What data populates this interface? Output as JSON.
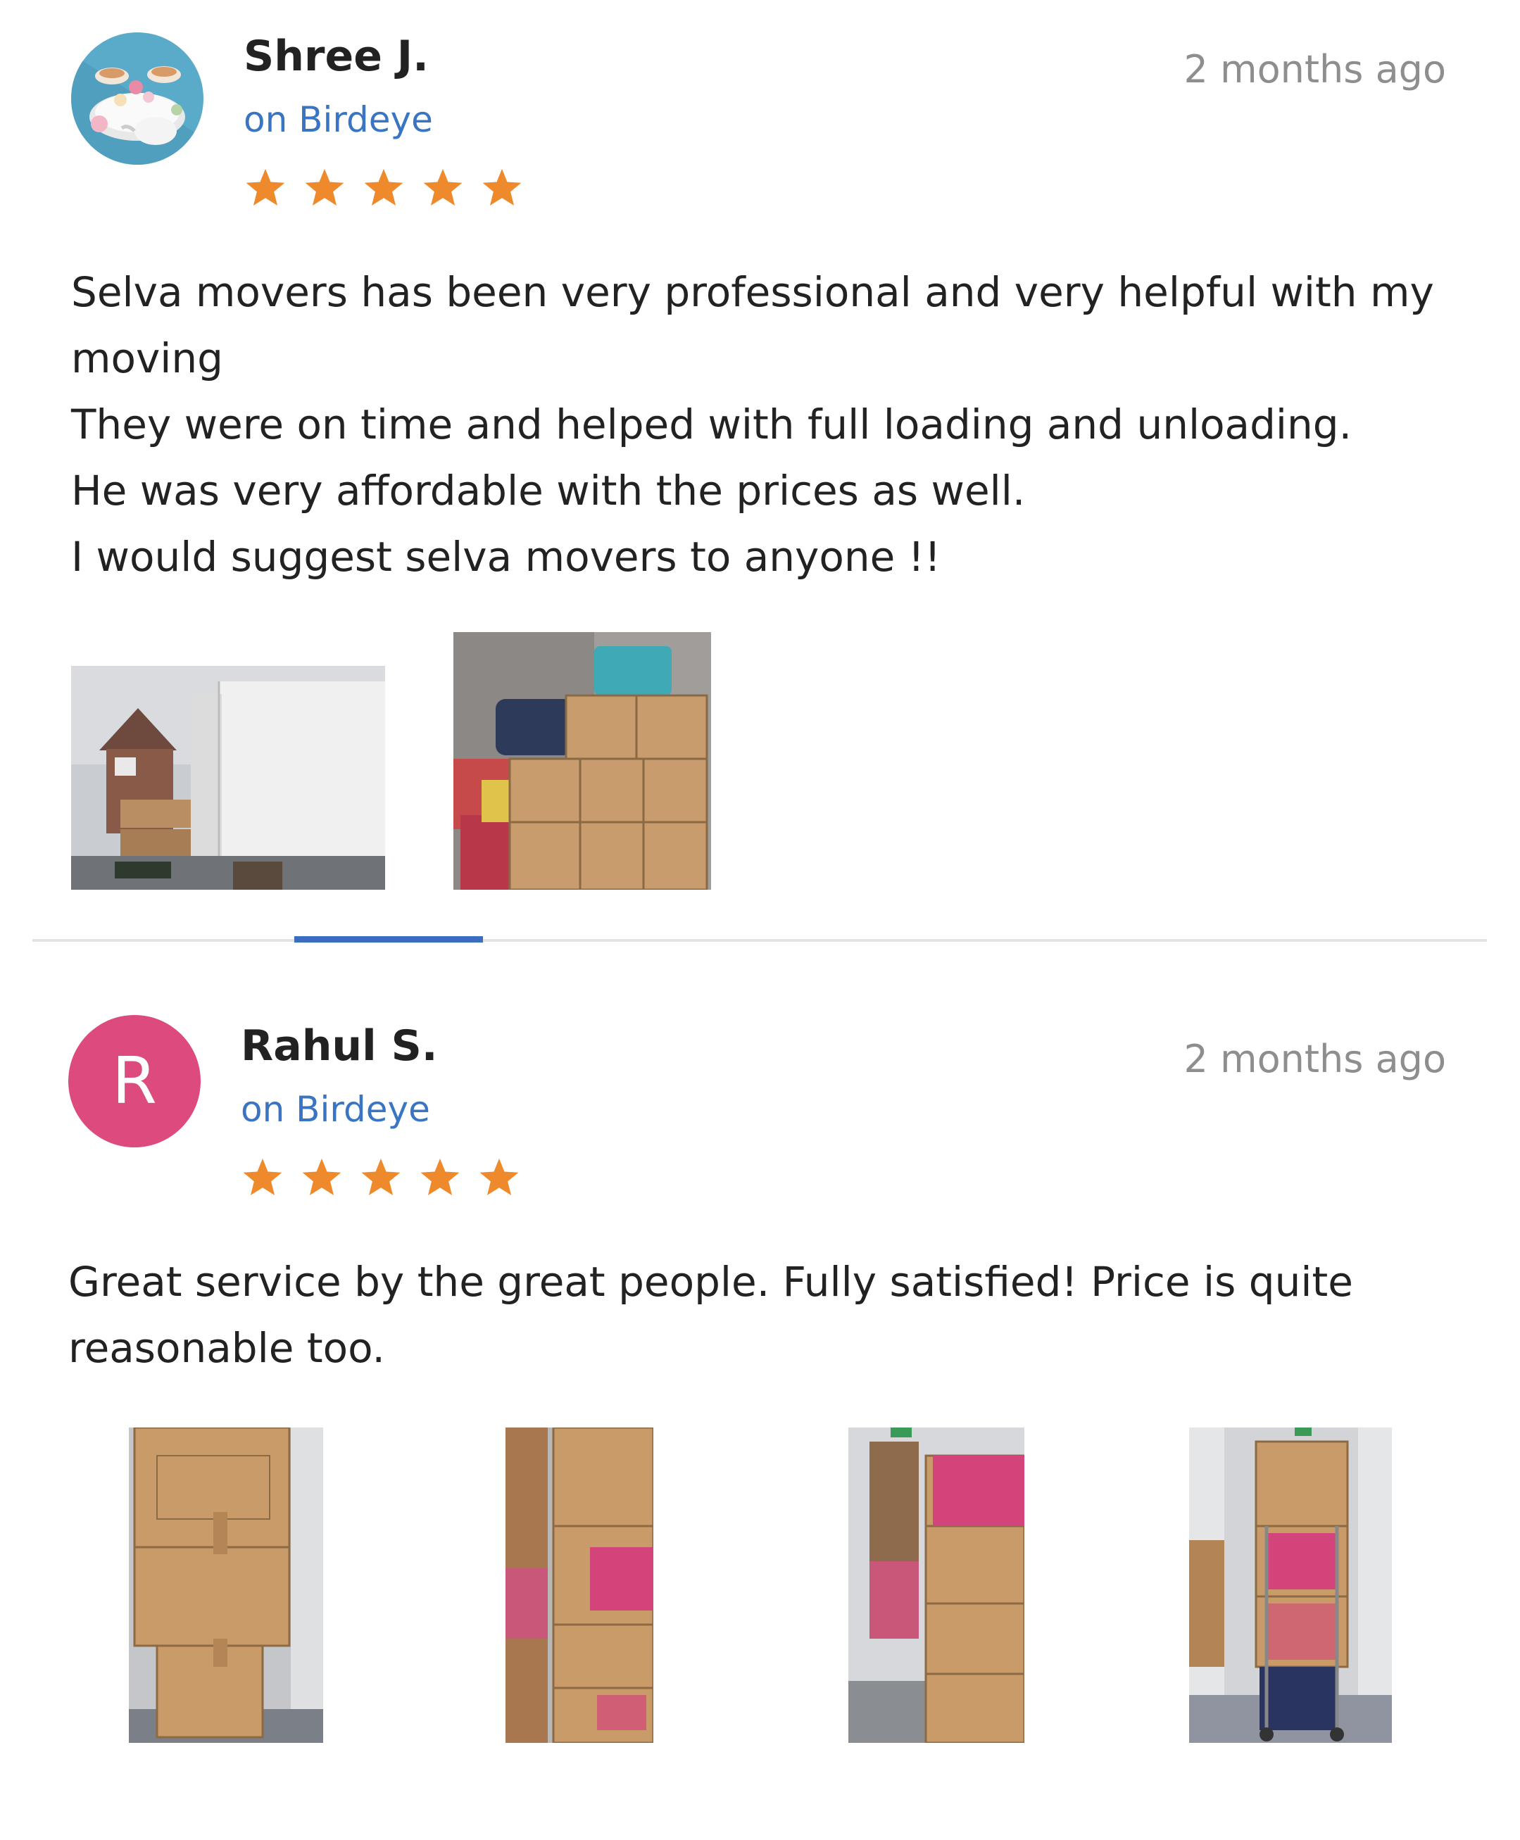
{
  "reviews": [
    {
      "author": "Shree J.",
      "source": "on Birdeye",
      "time": "2 months ago",
      "rating": 5,
      "text": "Selva movers has been very professional and very helpful with my moving\nThey were on time and helped with full loading and unloading.\nHe was very affordable with the prices as well.\nI would suggest selva movers to anyone !!",
      "avatar": {
        "type": "image",
        "icon": "teapot-cups-illustration"
      },
      "photos": [
        {
          "icon": "moving-truck-photo"
        },
        {
          "icon": "boxes-in-van-photo"
        }
      ]
    },
    {
      "author": "Rahul S.",
      "source": "on Birdeye",
      "time": "2 months ago",
      "rating": 5,
      "text": "Great service by the great people. Fully satisfied! Price is quite reasonable too.",
      "avatar": {
        "type": "letter",
        "letter": "R",
        "color": "#dc4a7e"
      },
      "photos": [
        {
          "icon": "stacked-boxes-photo"
        },
        {
          "icon": "boxes-hallway-photo"
        },
        {
          "icon": "moving-boxes-photo"
        },
        {
          "icon": "boxes-trolley-photo"
        }
      ]
    }
  ],
  "colors": {
    "star": "#ef8a2c",
    "source_link": "#3a75c4",
    "time": "#8e8e8e",
    "indicator": "#3a6dc0"
  }
}
